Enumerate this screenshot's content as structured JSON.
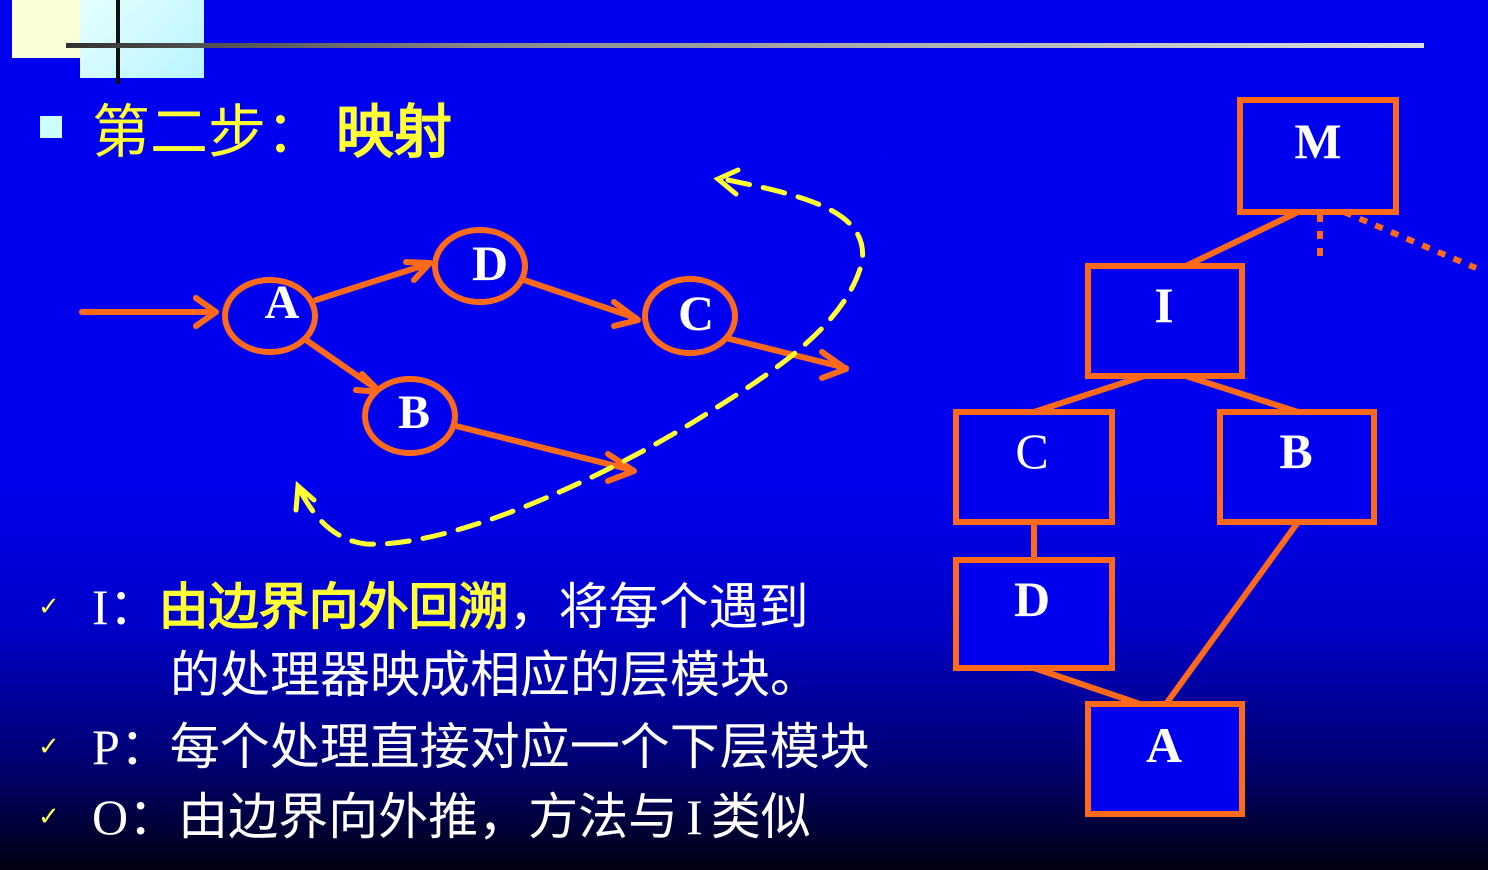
{
  "title": {
    "prefix": "第二步：",
    "emphasis": "映射"
  },
  "flow_diagram": {
    "nodes": {
      "A": "A",
      "D": "D",
      "C": "C",
      "B": "B"
    }
  },
  "tree_diagram": {
    "nodes": {
      "M": "M",
      "I": "I",
      "C": "C",
      "B": "B",
      "D": "D",
      "A": "A"
    }
  },
  "bullets": {
    "check_glyph": "✓",
    "i": {
      "key": "I",
      "colon": "：",
      "emphasis": "由边界向外回溯",
      "rest": "，将每个遇到",
      "continuation": "的处理器映成相应的层模块。"
    },
    "p": {
      "key": "P",
      "text": "：每个处理直接对应一个下层模块"
    },
    "o": {
      "key": "O",
      "text_before": "：由边界向外推，方法与",
      "key_ref": "I",
      "text_after": "类似"
    }
  },
  "colors": {
    "background": "#0000f0",
    "accent_orange": "#ff6a1a",
    "title_yellow": "#ffff33",
    "dashed_yellow": "#ffff33"
  }
}
